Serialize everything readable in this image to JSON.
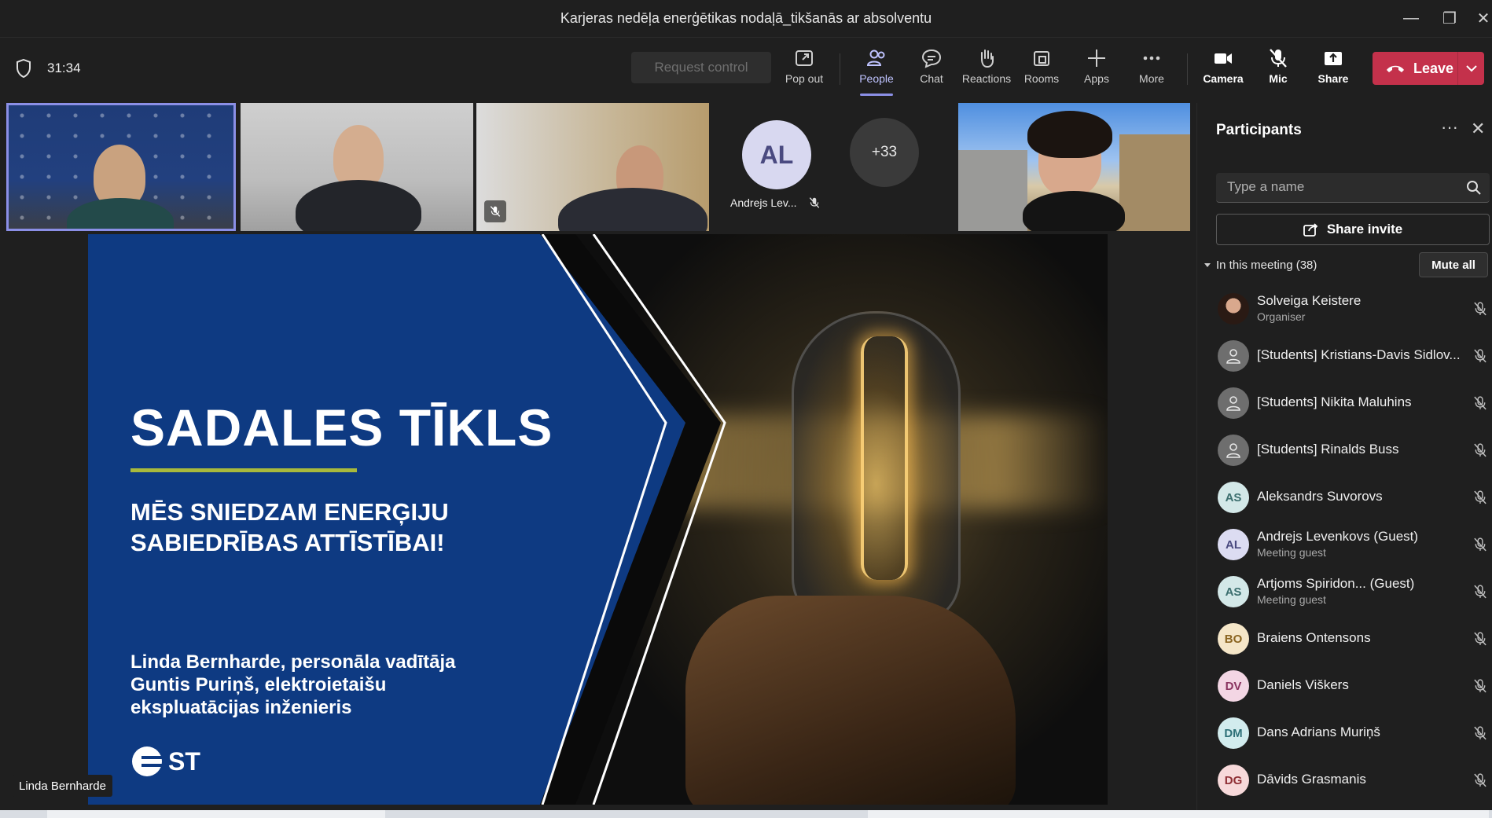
{
  "window": {
    "title": "Karjeras nedēļa enerģētikas nodaļā_tikšanās ar absolventu",
    "minimize": "—",
    "maximize": "❐",
    "close": "✕"
  },
  "toolbar": {
    "timer": "31:34",
    "request_control": "Request control",
    "pop_out": "Pop out",
    "people": "People",
    "chat": "Chat",
    "reactions": "Reactions",
    "rooms": "Rooms",
    "apps": "Apps",
    "more": "More",
    "camera": "Camera",
    "mic": "Mic",
    "share": "Share",
    "leave": "Leave",
    "leave_color": "#c4314b"
  },
  "video_strip": {
    "al_initials": "AL",
    "al_name": "Andrejs Lev...",
    "overflow_count": "+33"
  },
  "slide": {
    "title": "SADALES TĪKLS",
    "subtitle": "MĒS SNIEDZAM ENERĢIJU SABIEDRĪBAS ATTĪSTĪBAI!",
    "presenter_line1": "Linda Bernharde, personāla vadītāja",
    "presenter_line2": "Guntis Puriņš, elektroietaišu ekspluatācijas inženieris",
    "logo_text": "ST",
    "brand_color": "#0e3a82",
    "accent_color": "#a8b93c"
  },
  "presenter_tag": "Linda Bernharde",
  "panel": {
    "title": "Participants",
    "search_placeholder": "Type a name",
    "share_invite": "Share invite",
    "section": "In this meeting (38)",
    "mute_all": "Mute all",
    "participants": [
      {
        "name": "Solveiga Keistere",
        "role": "Organiser",
        "initials": "",
        "avatar": "photo"
      },
      {
        "name": "[Students] Kristians-Davis Sidlov...",
        "role": "",
        "initials": "",
        "avatar": "generic"
      },
      {
        "name": "[Students] Nikita Maluhins",
        "role": "",
        "initials": "",
        "avatar": "generic"
      },
      {
        "name": "[Students] Rinalds Buss",
        "role": "",
        "initials": "",
        "avatar": "generic"
      },
      {
        "name": "Aleksandrs Suvorovs",
        "role": "",
        "initials": "AS",
        "avatar": "initials"
      },
      {
        "name": "Andrejs Levenkovs (Guest)",
        "role": "Meeting guest",
        "initials": "AL",
        "avatar": "initials"
      },
      {
        "name": "Artjoms Spiridon... (Guest)",
        "role": "Meeting guest",
        "initials": "AS",
        "avatar": "initials"
      },
      {
        "name": "Braiens Ontensons",
        "role": "",
        "initials": "BO",
        "avatar": "initials"
      },
      {
        "name": "Daniels Viškers",
        "role": "",
        "initials": "DV",
        "avatar": "initials"
      },
      {
        "name": "Dans Adrians Muriņš",
        "role": "",
        "initials": "DM",
        "avatar": "initials"
      },
      {
        "name": "Dāvids Grasmanis",
        "role": "",
        "initials": "DG",
        "avatar": "initials"
      }
    ]
  }
}
